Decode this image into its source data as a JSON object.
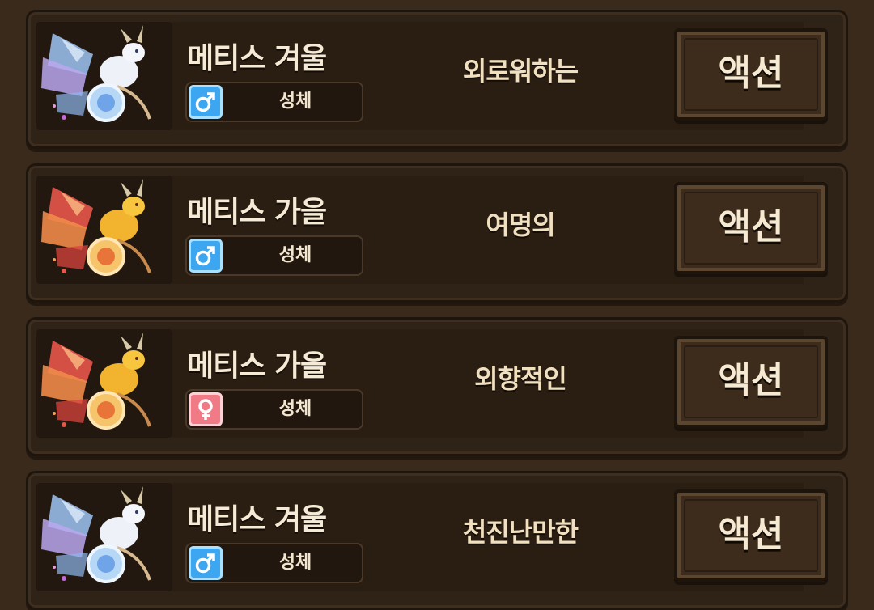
{
  "colors": {
    "background": "#3a2a1c",
    "card": "#2f2217",
    "male_badge": "#3da6f0",
    "female_badge": "#f07a85",
    "text": "#f5ead5"
  },
  "pets": [
    {
      "name": "메티스 겨울",
      "gender": "male",
      "gender_icon": "male-symbol-icon",
      "stage": "성체",
      "nature": "외로워하는",
      "action_label": "액션",
      "portrait": "winter-metis-dragon-icon"
    },
    {
      "name": "메티스 가을",
      "gender": "male",
      "gender_icon": "male-symbol-icon",
      "stage": "성체",
      "nature": "여명의",
      "action_label": "액션",
      "portrait": "autumn-metis-dragon-icon"
    },
    {
      "name": "메티스 가을",
      "gender": "female",
      "gender_icon": "female-symbol-icon",
      "stage": "성체",
      "nature": "외향적인",
      "action_label": "액션",
      "portrait": "autumn-metis-dragon-icon"
    },
    {
      "name": "메티스 겨울",
      "gender": "male",
      "gender_icon": "male-symbol-icon",
      "stage": "성체",
      "nature": "천진난만한",
      "action_label": "액션",
      "portrait": "winter-metis-dragon-icon"
    }
  ]
}
